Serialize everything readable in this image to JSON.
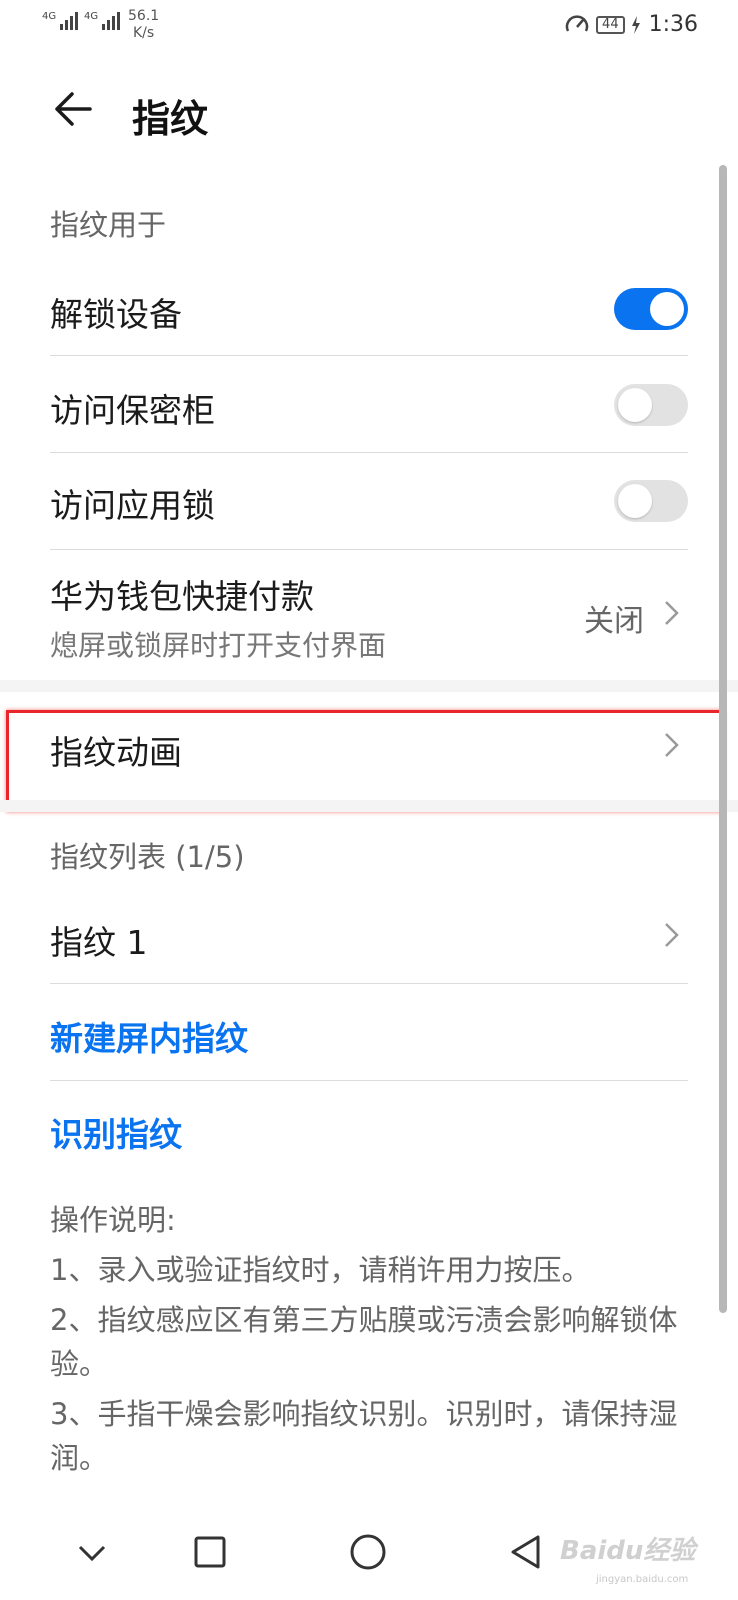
{
  "status_bar": {
    "signal_1_label": "4G",
    "signal_2_label": "4G",
    "net_speed_value": "56.1",
    "net_speed_unit": "K/s",
    "battery": "44",
    "time": "1:36"
  },
  "header": {
    "title": "指纹"
  },
  "usage_section": {
    "heading": "指纹用于",
    "items": [
      {
        "label": "解锁设备",
        "enabled": true
      },
      {
        "label": "访问保密柜",
        "enabled": false
      },
      {
        "label": "访问应用锁",
        "enabled": false
      }
    ],
    "wallet": {
      "label": "华为钱包快捷付款",
      "sublabel": "熄屏或锁屏时打开支付界面",
      "value": "关闭"
    }
  },
  "animation": {
    "label": "指纹动画"
  },
  "list_section": {
    "heading": "指纹列表 (1/5)",
    "items": [
      {
        "label": "指纹 1"
      }
    ]
  },
  "actions": {
    "new_fingerprint": "新建屏内指纹",
    "identify": "识别指纹"
  },
  "instructions": {
    "heading": "操作说明:",
    "lines": [
      "1、录入或验证指纹时，请稍许用力按压。",
      "2、指纹感应区有第三方贴膜或污渍会影响解锁体验。",
      "3、手指干燥会影响指纹识别。识别时，请保持湿润。"
    ]
  },
  "watermark": {
    "brand": "Baidu经验",
    "url": "jingyan.baidu.com"
  },
  "colors": {
    "accent": "#0a74f0",
    "highlight": "#e8262c"
  }
}
